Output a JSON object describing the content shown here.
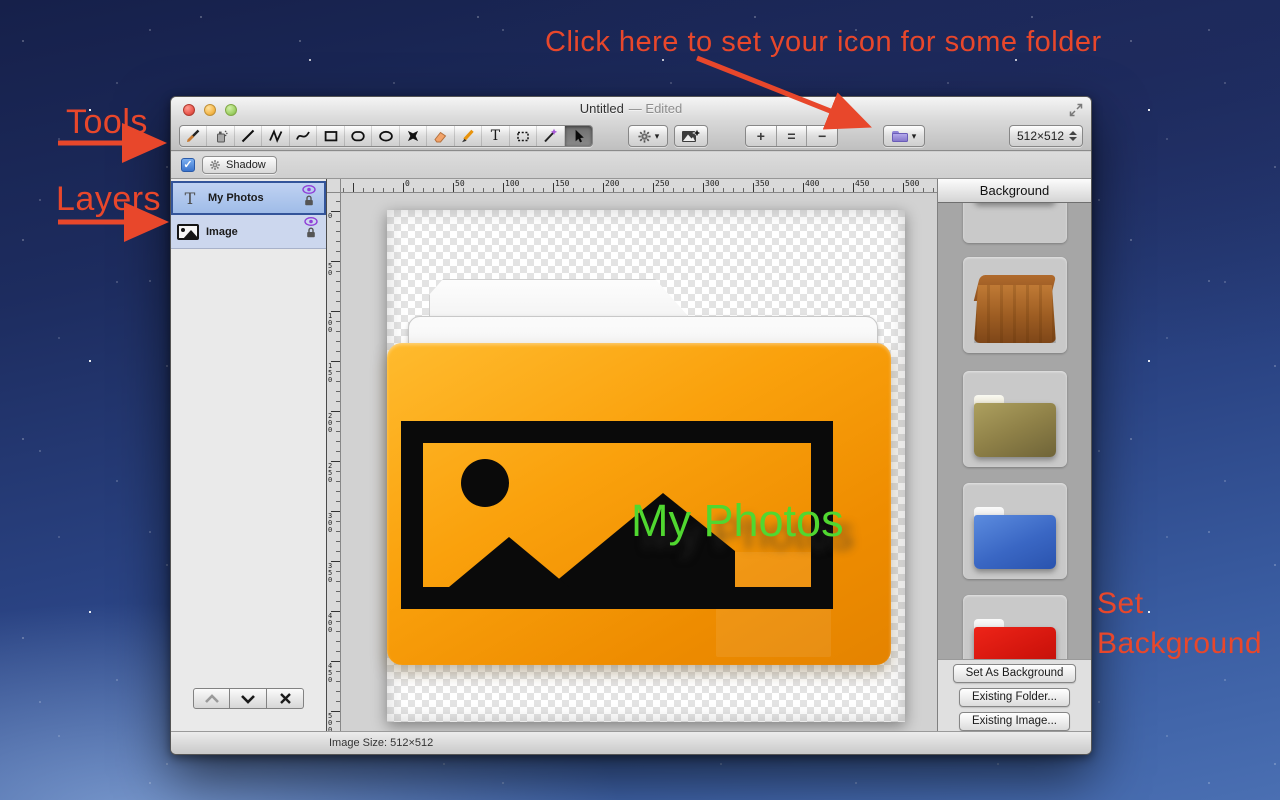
{
  "annotations": {
    "color": "#e8472b",
    "top_note": "Click here to set your icon for some folder",
    "tools": "Tools",
    "layers": "Layers",
    "set_background": "Set Background"
  },
  "window": {
    "title": "Untitled",
    "edited_suffix": "— Edited",
    "toolbar": {
      "tools": [
        "eyedropper",
        "spray",
        "line",
        "zigzag",
        "curve",
        "rectangle",
        "rounded-rectangle",
        "ellipse",
        "star",
        "eraser",
        "pencil",
        "text",
        "marquee-select",
        "magic-wand",
        "cursor"
      ],
      "selected_tool": "cursor",
      "size_value": "512×512"
    },
    "shadow": {
      "label": "Shadow",
      "checked": true
    },
    "layers_panel": {
      "items": [
        {
          "label": "My Photos",
          "type": "text-layer",
          "visible": true,
          "locked": true,
          "selected": true
        },
        {
          "label": "Image",
          "type": "image-layer",
          "visible": true,
          "locked": true,
          "selected": false
        }
      ]
    },
    "canvas": {
      "ruler_labels": [
        "0",
        "50",
        "100",
        "150",
        "200",
        "250",
        "300",
        "350",
        "400",
        "450",
        "500"
      ],
      "icon_text": "My Photos",
      "icon_text_color": "#50d830",
      "folder_color": "#f89b06"
    },
    "sidebar": {
      "header": "Background",
      "thumbnails": [
        "wood-folder-front",
        "wood-folder-open",
        "khaki-folder",
        "blue-folder",
        "red-folder"
      ],
      "buttons": [
        "Set As Background",
        "Existing Folder...",
        "Existing Image..."
      ]
    },
    "status_bar": "Image Size: 512×512"
  },
  "icons": {
    "plus": "+",
    "equals": "=",
    "minus": "−",
    "dropdown": "▾",
    "check": "✓",
    "text_tool": "T",
    "star_tool": "✖"
  }
}
